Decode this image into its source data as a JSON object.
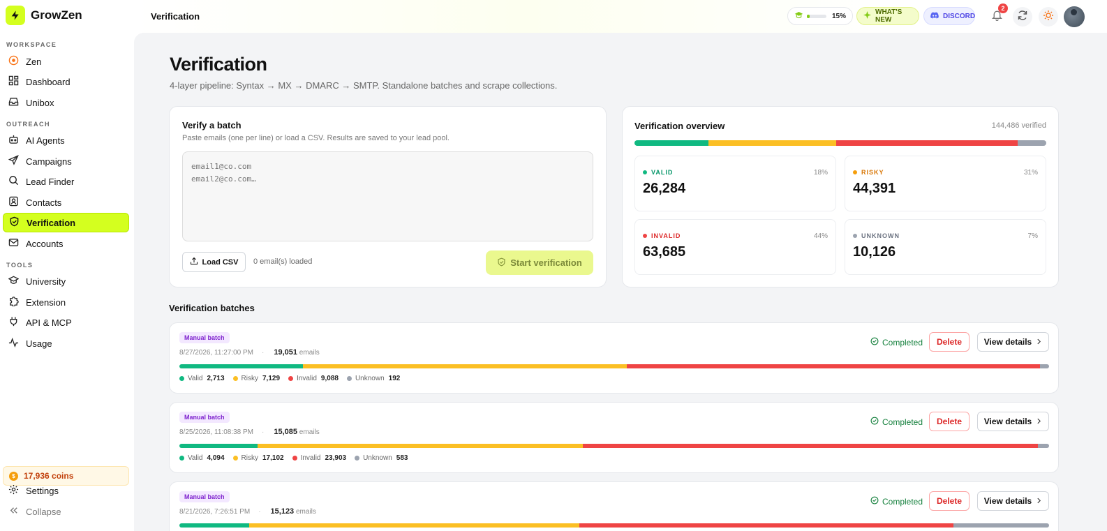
{
  "app": {
    "name": "GrowZen",
    "brand_color": "#d4ff1f"
  },
  "sidebar": {
    "sections": {
      "workspace": "WORKSPACE",
      "outreach": "OUTREACH",
      "tools": "TOOLS"
    },
    "items": [
      {
        "label": "Zen",
        "icon": "zen-icon"
      },
      {
        "label": "Dashboard",
        "icon": "dashboard-icon"
      },
      {
        "label": "Unibox",
        "icon": "inbox-icon"
      },
      {
        "label": "AI Agents",
        "icon": "bot-icon"
      },
      {
        "label": "Campaigns",
        "icon": "send-icon"
      },
      {
        "label": "Lead Finder",
        "icon": "search-icon"
      },
      {
        "label": "Contacts",
        "icon": "contacts-icon"
      },
      {
        "label": "Verification",
        "icon": "shield-check-icon",
        "active": true
      },
      {
        "label": "Accounts",
        "icon": "mail-icon"
      },
      {
        "label": "University",
        "icon": "graduation-cap-icon"
      },
      {
        "label": "Extension",
        "icon": "puzzle-icon"
      },
      {
        "label": "API & MCP",
        "icon": "plug-icon"
      },
      {
        "label": "Usage",
        "icon": "activity-icon"
      }
    ],
    "coins": "17,936 coins",
    "settings": "Settings",
    "collapse": "Collapse"
  },
  "topbar": {
    "title": "Verification",
    "progress_pct": "15%",
    "progress_value": 0.15,
    "whats_new": "WHAT'S NEW",
    "discord": "DISCORD",
    "notification_count": "2"
  },
  "page": {
    "title": "Verification",
    "subtitle": "4-layer pipeline: Syntax → MX → DMARC → SMTP. Standalone batches and scrape collections."
  },
  "verify_batch": {
    "title": "Verify a batch",
    "hint": "Paste emails (one per line) or load a CSV. Results are saved to your lead pool.",
    "placeholder": "email1@co.com\nemail2@co.com…",
    "load_csv": "Load CSV",
    "loaded": "0 email(s) loaded",
    "start": "Start verification"
  },
  "overview": {
    "title": "Verification overview",
    "total": "144,486 verified",
    "bar": [
      0.18,
      0.31,
      0.44,
      0.07
    ],
    "stats": [
      {
        "label": "VALID",
        "pct": "18%",
        "value": "26,284",
        "color": "#10b981"
      },
      {
        "label": "RISKY",
        "pct": "31%",
        "value": "44,391",
        "color": "#f59e0b"
      },
      {
        "label": "INVALID",
        "pct": "44%",
        "value": "63,685",
        "color": "#ef4444"
      },
      {
        "label": "UNKNOWN",
        "pct": "7%",
        "value": "10,126",
        "color": "#9ca3af"
      }
    ]
  },
  "colors": {
    "valid": "#10b981",
    "risky": "#fbbf24",
    "invalid": "#ef4444",
    "unknown": "#9ca3af"
  },
  "batches": {
    "title": "Verification batches",
    "status_label": "Completed",
    "delete_label": "Delete",
    "view_label": "View details",
    "emails_label": "emails",
    "legend_labels": {
      "valid": "Valid",
      "risky": "Risky",
      "invalid": "Invalid",
      "unknown": "Unknown"
    },
    "items": [
      {
        "tag": "Manual batch",
        "date": "8/27/2026, 11:27:00 PM",
        "count": "19,051",
        "valid": "2,713",
        "risky": "7,129",
        "invalid": "9,088",
        "unknown": "192",
        "dist": [
          2713,
          7129,
          9088,
          192
        ]
      },
      {
        "tag": "Manual batch",
        "date": "8/25/2026, 11:08:38 PM",
        "count": "15,085",
        "valid": "4,094",
        "risky": "17,102",
        "invalid": "23,903",
        "unknown": "583",
        "dist": [
          4094,
          17102,
          23903,
          583
        ]
      },
      {
        "tag": "Manual batch",
        "date": "8/21/2026, 7:26:51 PM",
        "count": "15,123",
        "valid": "",
        "risky": "",
        "invalid": "",
        "unknown": "",
        "dist": [
          0.08,
          0.38,
          0.43,
          0.11
        ]
      }
    ]
  }
}
